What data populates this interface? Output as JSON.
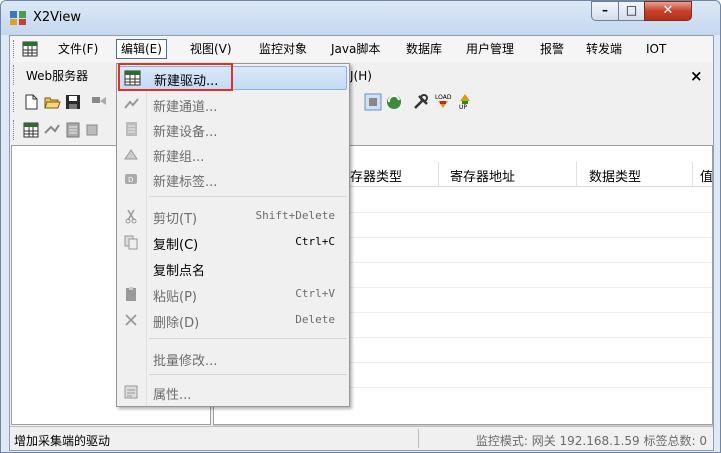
{
  "window": {
    "title": "X2View"
  },
  "menubar": {
    "items": [
      {
        "label": "文件(F)"
      },
      {
        "label": "编辑(E)"
      },
      {
        "label": "视图(V)"
      },
      {
        "label": "监控对象"
      },
      {
        "label": "Java脚本"
      },
      {
        "label": "数据库"
      },
      {
        "label": "用户管理"
      },
      {
        "label": "报警"
      },
      {
        "label": "转发端"
      },
      {
        "label": "IOT"
      }
    ]
  },
  "row2": {
    "web_server": "Web服务器",
    "help_fragment": "J(H)",
    "close_glyph": "×"
  },
  "grid": {
    "columns": [
      "存器类型",
      "寄存器地址",
      "数据类型",
      "值"
    ]
  },
  "edit_menu": {
    "items": [
      {
        "label": "新建驱动...",
        "enabled": true
      },
      {
        "label": "新建通道...",
        "enabled": false
      },
      {
        "label": "新建设备...",
        "enabled": false
      },
      {
        "label": "新建组...",
        "enabled": false
      },
      {
        "label": "新建标签...",
        "enabled": false
      },
      {
        "label": "剪切(T)",
        "shortcut": "Shift+Delete",
        "enabled": false
      },
      {
        "label": "复制(C)",
        "shortcut": "Ctrl+C",
        "enabled": true
      },
      {
        "label": "复制点名",
        "enabled": true
      },
      {
        "label": "粘贴(P)",
        "shortcut": "Ctrl+V",
        "enabled": false
      },
      {
        "label": "删除(D)",
        "shortcut": "Delete",
        "enabled": false
      },
      {
        "label": "批量修改...",
        "enabled": false
      },
      {
        "label": "属性...",
        "enabled": false
      }
    ]
  },
  "status": {
    "message": "增加采集端的驱动",
    "mode": "监控模式: 网关 192.168.1.59 标签总数: 0"
  },
  "colors": {
    "highlight_border": "#e0302a",
    "close_button": "#c6412b"
  }
}
